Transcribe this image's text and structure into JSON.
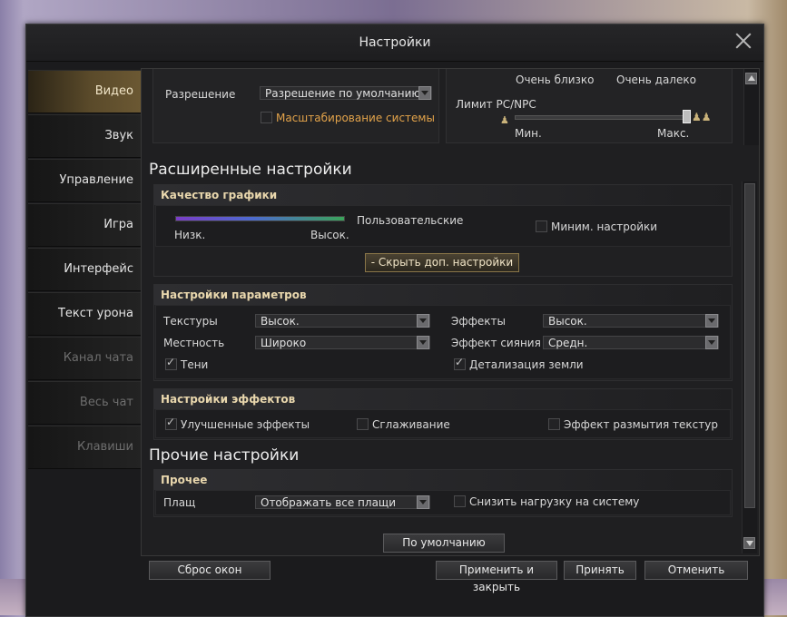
{
  "window": {
    "title": "Настройки"
  },
  "sidebar": {
    "items": [
      {
        "label": "Видео",
        "active": true
      },
      {
        "label": "Звук"
      },
      {
        "label": "Управление"
      },
      {
        "label": "Игра"
      },
      {
        "label": "Интерфейс"
      },
      {
        "label": "Текст урона"
      },
      {
        "label": "Канал чата",
        "disabled": true
      },
      {
        "label": "Весь чат",
        "disabled": true
      },
      {
        "label": "Клавиши",
        "disabled": true
      }
    ]
  },
  "top": {
    "resolution_label": "Разрешение",
    "resolution_value": "Разрешение по умолчанию",
    "scaling_label": "Масштабирование системы",
    "distance_near": "Очень близко",
    "distance_far": "Очень далеко",
    "pc_npc_label": "Лимит PC/NPC",
    "pc_npc_min": "Мин.",
    "pc_npc_max": "Макс."
  },
  "advanced": {
    "title": "Расширенные настройки",
    "graphics_quality": {
      "heading": "Качество графики",
      "low": "Низк.",
      "high": "Высок.",
      "preset": "Пользовательские",
      "min_settings": "Миним. настройки",
      "hide_button": "-  Скрыть доп. настройки"
    },
    "params": {
      "heading": "Настройки параметров",
      "textures_label": "Текстуры",
      "textures_value": "Высок.",
      "effects_label": "Эффекты",
      "effects_value": "Высок.",
      "terrain_label": "Местность",
      "terrain_value": "Широко",
      "glow_label": "Эффект сияния",
      "glow_value": "Средн.",
      "shadows_label": "Тени",
      "shadows_checked": true,
      "ground_detail_label": "Детализация земли",
      "ground_detail_checked": true
    },
    "effects": {
      "heading": "Настройки эффектов",
      "improved_label": "Улучшенные эффекты",
      "improved_checked": true,
      "aa_label": "Сглаживание",
      "aa_checked": false,
      "blur_label": "Эффект размытия текстур",
      "blur_checked": false
    }
  },
  "other": {
    "title": "Прочие настройки",
    "heading": "Прочее",
    "cloak_label": "Плащ",
    "cloak_value": "Отображать все плащи",
    "reduce_load_label": "Снизить нагрузку на систему"
  },
  "buttons": {
    "defaults": "По умолчанию",
    "reset_windows": "Сброс окон",
    "apply_close": "Применить и закрыть",
    "accept": "Принять",
    "cancel": "Отменить"
  }
}
